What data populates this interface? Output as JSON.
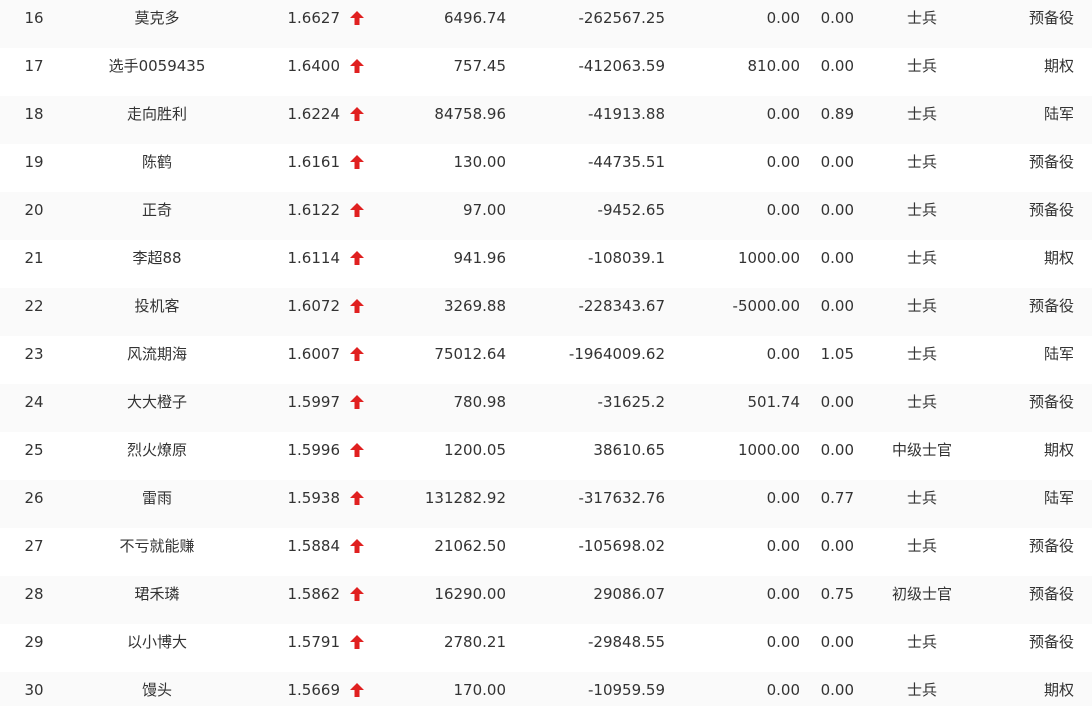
{
  "colors": {
    "text": "#333333",
    "up_arrow": "#e02020",
    "row_alt": "#fafafa"
  },
  "rows": [
    {
      "rank": "16",
      "name": "莫克多",
      "ratio": "1.6627",
      "trend": "up-arrow-icon",
      "col4": "6496.74",
      "col5": "-262567.25",
      "col6": "0.00",
      "col7": "0.00",
      "level": "士兵",
      "group": "预备役"
    },
    {
      "rank": "17",
      "name": "选手0059435",
      "ratio": "1.6400",
      "trend": "up-arrow-icon",
      "col4": "757.45",
      "col5": "-412063.59",
      "col6": "810.00",
      "col7": "0.00",
      "level": "士兵",
      "group": "期权"
    },
    {
      "rank": "18",
      "name": "走向胜利",
      "ratio": "1.6224",
      "trend": "up-arrow-icon",
      "col4": "84758.96",
      "col5": "-41913.88",
      "col6": "0.00",
      "col7": "0.89",
      "level": "士兵",
      "group": "陆军"
    },
    {
      "rank": "19",
      "name": "陈鹤",
      "ratio": "1.6161",
      "trend": "up-arrow-icon",
      "col4": "130.00",
      "col5": "-44735.51",
      "col6": "0.00",
      "col7": "0.00",
      "level": "士兵",
      "group": "预备役"
    },
    {
      "rank": "20",
      "name": "正奇",
      "ratio": "1.6122",
      "trend": "up-arrow-icon",
      "col4": "97.00",
      "col5": "-9452.65",
      "col6": "0.00",
      "col7": "0.00",
      "level": "士兵",
      "group": "预备役"
    },
    {
      "rank": "21",
      "name": "李超88",
      "ratio": "1.6114",
      "trend": "up-arrow-icon",
      "col4": "941.96",
      "col5": "-108039.1",
      "col6": "1000.00",
      "col7": "0.00",
      "level": "士兵",
      "group": "期权"
    },
    {
      "rank": "22",
      "name": "投机客",
      "ratio": "1.6072",
      "trend": "up-arrow-icon",
      "col4": "3269.88",
      "col5": "-228343.67",
      "col6": "-5000.00",
      "col7": "0.00",
      "level": "士兵",
      "group": "预备役"
    },
    {
      "rank": "23",
      "name": "风流期海",
      "ratio": "1.6007",
      "trend": "up-arrow-icon",
      "col4": "75012.64",
      "col5": "-1964009.62",
      "col6": "0.00",
      "col7": "1.05",
      "level": "士兵",
      "group": "陆军"
    },
    {
      "rank": "24",
      "name": "大大橙子",
      "ratio": "1.5997",
      "trend": "up-arrow-icon",
      "col4": "780.98",
      "col5": "-31625.2",
      "col6": "501.74",
      "col7": "0.00",
      "level": "士兵",
      "group": "预备役"
    },
    {
      "rank": "25",
      "name": "烈火燎原",
      "ratio": "1.5996",
      "trend": "up-arrow-icon",
      "col4": "1200.05",
      "col5": "38610.65",
      "col6": "1000.00",
      "col7": "0.00",
      "level": "中级士官",
      "group": "期权"
    },
    {
      "rank": "26",
      "name": "雷雨",
      "ratio": "1.5938",
      "trend": "up-arrow-icon",
      "col4": "131282.92",
      "col5": "-317632.76",
      "col6": "0.00",
      "col7": "0.77",
      "level": "士兵",
      "group": "陆军"
    },
    {
      "rank": "27",
      "name": "不亏就能赚",
      "ratio": "1.5884",
      "trend": "up-arrow-icon",
      "col4": "21062.50",
      "col5": "-105698.02",
      "col6": "0.00",
      "col7": "0.00",
      "level": "士兵",
      "group": "预备役"
    },
    {
      "rank": "28",
      "name": "珺禾璘",
      "ratio": "1.5862",
      "trend": "up-arrow-icon",
      "col4": "16290.00",
      "col5": "29086.07",
      "col6": "0.00",
      "col7": "0.75",
      "level": "初级士官",
      "group": "预备役"
    },
    {
      "rank": "29",
      "name": "以小博大",
      "ratio": "1.5791",
      "trend": "up-arrow-icon",
      "col4": "2780.21",
      "col5": "-29848.55",
      "col6": "0.00",
      "col7": "0.00",
      "level": "士兵",
      "group": "预备役"
    },
    {
      "rank": "30",
      "name": "馒头",
      "ratio": "1.5669",
      "trend": "up-arrow-icon",
      "col4": "170.00",
      "col5": "-10959.59",
      "col6": "0.00",
      "col7": "0.00",
      "level": "士兵",
      "group": "期权"
    }
  ]
}
